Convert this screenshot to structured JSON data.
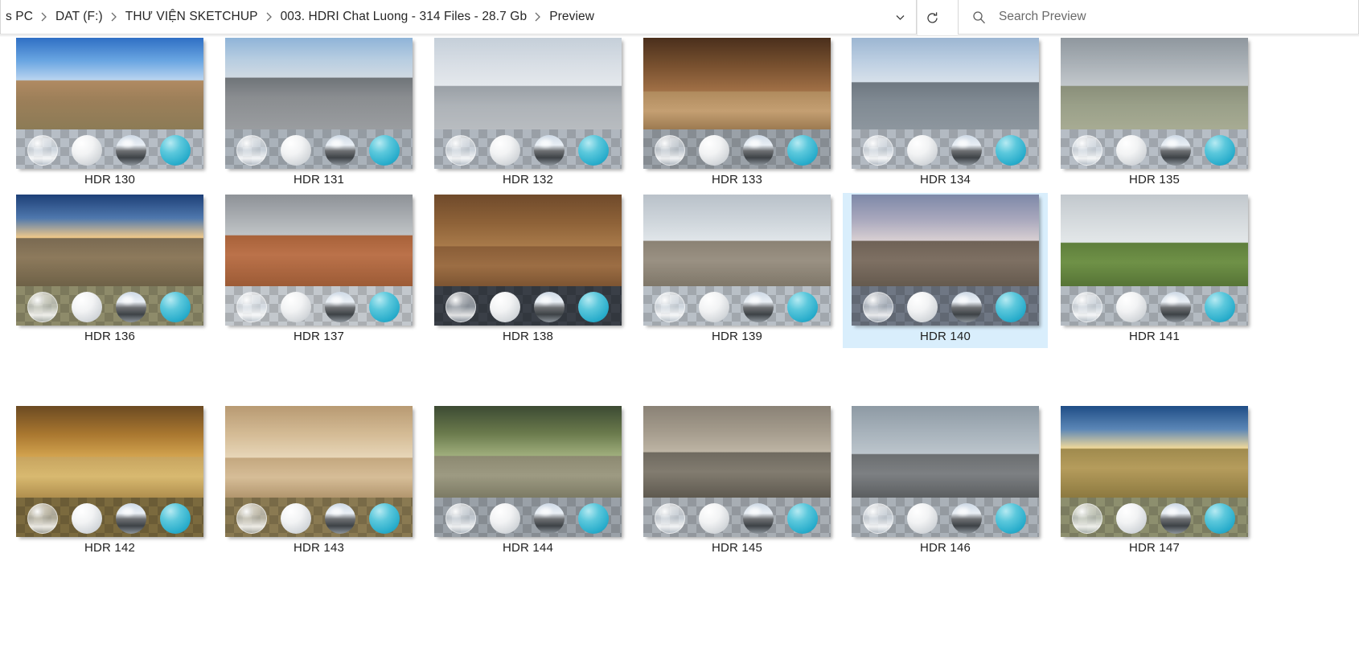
{
  "window": {
    "app": "File Explorer",
    "view_mode": "Extra large icons"
  },
  "addressbar": {
    "crumbs": [
      "s PC",
      "DAT  (F:)",
      "THƯ VIỆN SKETCHUP",
      "003. HDRI Chat Luong - 314 Files - 28.7 Gb",
      "Preview"
    ],
    "history_icon": "chevron-down-icon",
    "refresh_icon": "refresh-icon",
    "refresh_title": "Refresh"
  },
  "search": {
    "icon": "search-icon",
    "placeholder": "Search Preview",
    "value": ""
  },
  "selection": {
    "selected_label": "HDR 140",
    "highlight_color": "#d9eefc"
  },
  "grid": {
    "columns": 6,
    "rows": 3,
    "items": [
      {
        "label": "HDR 130",
        "scene": "desert-canyon-blue-sky",
        "sky": [
          "#2f6fc4",
          "#6aa6e2",
          "#b9d4ef"
        ],
        "ground": [
          "#b08a62",
          "#9c7f59",
          "#8c7b56"
        ],
        "horizon": 46,
        "floor": "#b7bec6"
      },
      {
        "label": "HDR 131",
        "scene": "urban-plaza-fountain",
        "sky": [
          "#8fb4d8",
          "#b7cde1",
          "#cfd9e2"
        ],
        "ground": [
          "#6f7479",
          "#8a8d90",
          "#9a9da0"
        ],
        "horizon": 43,
        "floor": "#aab2ba"
      },
      {
        "label": "HDR 132",
        "scene": "neoclassical-building-square",
        "sky": [
          "#c5cfd9",
          "#d8dee5",
          "#e4e8ec"
        ],
        "ground": [
          "#9aa0a6",
          "#aeb3b8",
          "#b8bcc0"
        ],
        "horizon": 52,
        "floor": "#b0b7bf"
      },
      {
        "label": "HDR 133",
        "scene": "wooden-barn-interior",
        "sky": [
          "#4a2f1c",
          "#7a5230",
          "#a07046"
        ],
        "ground": [
          "#b08b5e",
          "#c49f72",
          "#9c7a51"
        ],
        "horizon": 58,
        "floor": "#9aa1a8"
      },
      {
        "label": "HDR 134",
        "scene": "open-parking-overcast",
        "sky": [
          "#9cb6d2",
          "#bdcfe2",
          "#d6e0ea"
        ],
        "ground": [
          "#6e7780",
          "#808a93",
          "#8d969e"
        ],
        "horizon": 48,
        "floor": "#b3bac2"
      },
      {
        "label": "HDR 135",
        "scene": "cloudy-field-trees",
        "sky": [
          "#8f979e",
          "#aab1b7",
          "#c2c7cb"
        ],
        "ground": [
          "#8a8f7a",
          "#9aa089",
          "#a7ab93"
        ],
        "horizon": 52,
        "floor": "#b7bec6"
      },
      {
        "label": "HDR 136",
        "scene": "desert-sunset-horizon",
        "sky": [
          "#1d3f77",
          "#4f78ad",
          "#f0c98a"
        ],
        "ground": [
          "#7a6a52",
          "#8d7a5c",
          "#6e6147"
        ],
        "horizon": 47,
        "floor": "#8e8b6a"
      },
      {
        "label": "HDR 137",
        "scene": "overcast-red-dirt",
        "sky": [
          "#8e9297",
          "#a9adb1",
          "#bfc3c6"
        ],
        "ground": [
          "#a8623a",
          "#bb724a",
          "#9c5b36"
        ],
        "horizon": 44,
        "floor": "#c3c8cd"
      },
      {
        "label": "HDR 138",
        "scene": "wooden-pavilion-interior",
        "sky": [
          "#6f4a2b",
          "#8e6238",
          "#a87a4a"
        ],
        "ground": [
          "#8a5e38",
          "#9c6e44",
          "#7d5532"
        ],
        "horizon": 56,
        "floor": "#3a3f47"
      },
      {
        "label": "HDR 139",
        "scene": "dusk-desert-plain",
        "sky": [
          "#b9c1c9",
          "#cdd4da",
          "#e0e5e9"
        ],
        "ground": [
          "#8b8274",
          "#9a9183",
          "#7f7769"
        ],
        "horizon": 50,
        "floor": "#b9c0c7"
      },
      {
        "label": "HDR 140",
        "scene": "twilight-desert-shack",
        "sky": [
          "#7d88a8",
          "#a9a8bd",
          "#d8cfd2"
        ],
        "ground": [
          "#6f6256",
          "#7e7063",
          "#655a4e"
        ],
        "horizon": 50,
        "floor": "#6f7784"
      },
      {
        "label": "HDR 141",
        "scene": "green-meadow-overcast",
        "sky": [
          "#c2c8cd",
          "#d5dadd",
          "#e3e7e9"
        ],
        "ground": [
          "#5f7f3c",
          "#6f9147",
          "#567436"
        ],
        "horizon": 52,
        "floor": "#b4bbc2"
      },
      {
        "label": "HDR 142",
        "scene": "warm-hotel-lobby-interior",
        "sky": [
          "#6b4a22",
          "#a8762f",
          "#d2a34e"
        ],
        "ground": [
          "#c8a560",
          "#d8b970",
          "#b08f4e"
        ],
        "horizon": 55,
        "floor": "#7b6a3e"
      },
      {
        "label": "HDR 143",
        "scene": "bedroom-interior-daylight",
        "sky": [
          "#b89a72",
          "#d4bb95",
          "#e7d6b8"
        ],
        "ground": [
          "#c4a87f",
          "#d6bd97",
          "#b2966e"
        ],
        "horizon": 56,
        "floor": "#8a7a52"
      },
      {
        "label": "HDR 144",
        "scene": "park-path-large-tree",
        "sky": [
          "#3c4a33",
          "#6a7a4c",
          "#9fae7c"
        ],
        "ground": [
          "#8d8a72",
          "#9d9a82",
          "#7c7a64"
        ],
        "horizon": 54,
        "floor": "#9aa1a8"
      },
      {
        "label": "HDR 145",
        "scene": "factory-workshop-interior",
        "sky": [
          "#8a8276",
          "#a49b8c",
          "#bdb4a4"
        ],
        "ground": [
          "#6f6a60",
          "#827c70",
          "#5e594f"
        ],
        "horizon": 50,
        "floor": "#a8aeb4"
      },
      {
        "label": "HDR 146",
        "scene": "industrial-hall-interior",
        "sky": [
          "#8e9aa4",
          "#a7b2bb",
          "#bcc5cc"
        ],
        "ground": [
          "#6b6e70",
          "#7d8083",
          "#5b5e60"
        ],
        "horizon": 52,
        "floor": "#aab1b8"
      },
      {
        "label": "HDR 147",
        "scene": "sunset-field-horizon",
        "sky": [
          "#1f4d86",
          "#5b86b6",
          "#efd89a"
        ],
        "ground": [
          "#a08b4e",
          "#b59c5c",
          "#8c7940"
        ],
        "horizon": 46,
        "floor": "#8d8f6e"
      }
    ]
  },
  "spheres": {
    "names": [
      "glass-sphere",
      "diffuse-white-sphere",
      "chrome-sphere",
      "cyan-glossy-sphere"
    ]
  }
}
